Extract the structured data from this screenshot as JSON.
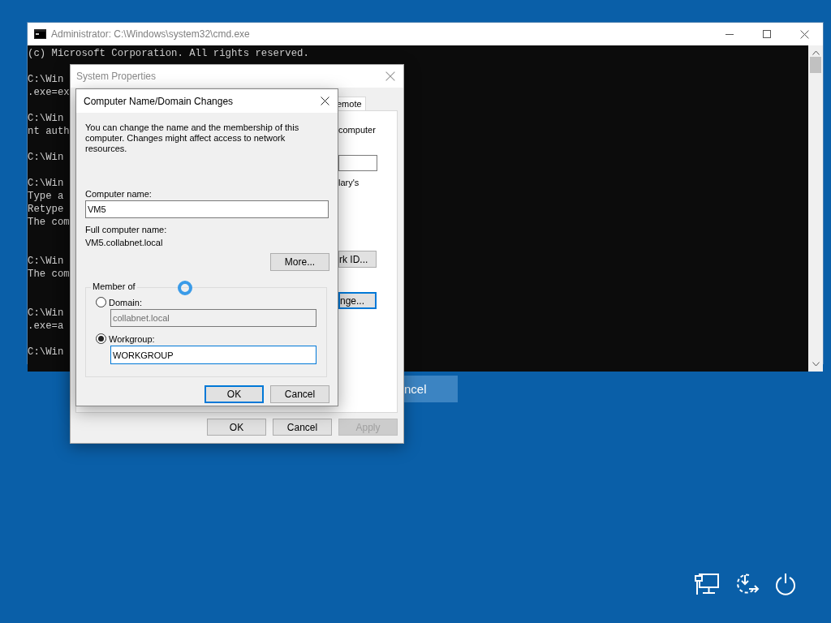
{
  "console_window": {
    "title": "Administrator: C:\\Windows\\system32\\cmd.exe",
    "paragraphs": [
      {
        "lines": [
          "(c) Microsoft Corporation. All rights reserved."
        ],
        "extra_gap": false
      },
      {
        "lines": [
          "C:\\Win",
          ".exe=ex"
        ],
        "extra_gap": false
      },
      {
        "lines": [
          "C:\\Win",
          "nt auth"
        ],
        "extra_gap": false
      },
      {
        "lines": [
          "C:\\Win"
        ],
        "extra_gap": false
      },
      {
        "lines": [
          "C:\\Win",
          "Type a",
          "Retype",
          "The com"
        ],
        "extra_gap": true
      },
      {
        "lines": [
          "C:\\Win",
          "The com"
        ],
        "extra_gap": true
      },
      {
        "lines": [
          "C:\\Win",
          ".exe=a"
        ],
        "extra_gap": false
      },
      {
        "lines": [
          "C:\\Win"
        ],
        "extra_gap": false
      }
    ]
  },
  "behind_button": {
    "label": "ncel"
  },
  "system_properties": {
    "title": "System Properties",
    "tabs": [
      {
        "label": "emote",
        "selected": true
      }
    ],
    "panel_items": [
      {
        "kind": "text",
        "text": "computer"
      },
      {
        "kind": "field"
      },
      {
        "kind": "text",
        "text": "lary's"
      },
      {
        "kind": "button",
        "text": "rk ID...",
        "default": false
      },
      {
        "kind": "button",
        "text": "nge...",
        "default": true
      }
    ],
    "buttons": [
      {
        "label": "OK",
        "disabled": false
      },
      {
        "label": "Cancel",
        "disabled": false
      },
      {
        "label": "Apply",
        "disabled": true
      }
    ]
  },
  "dialog": {
    "title": "Computer Name/Domain Changes",
    "description": "You can change the name and the membership of this computer. Changes might affect access to network resources.",
    "computer_name_label": "Computer name:",
    "computer_name": "VM5",
    "full_name_label": "Full computer name:",
    "full_name": "VM5.collabnet.local",
    "more_button": "More...",
    "member_of": {
      "legend": "Member of",
      "options": [
        {
          "label": "Domain:",
          "selected": false,
          "value": "collabnet.local"
        },
        {
          "label": "Workgroup:",
          "selected": true,
          "value": "WORKGROUP"
        }
      ]
    },
    "buttons": [
      {
        "label": "OK",
        "default": true
      },
      {
        "label": "Cancel",
        "default": false
      }
    ]
  }
}
